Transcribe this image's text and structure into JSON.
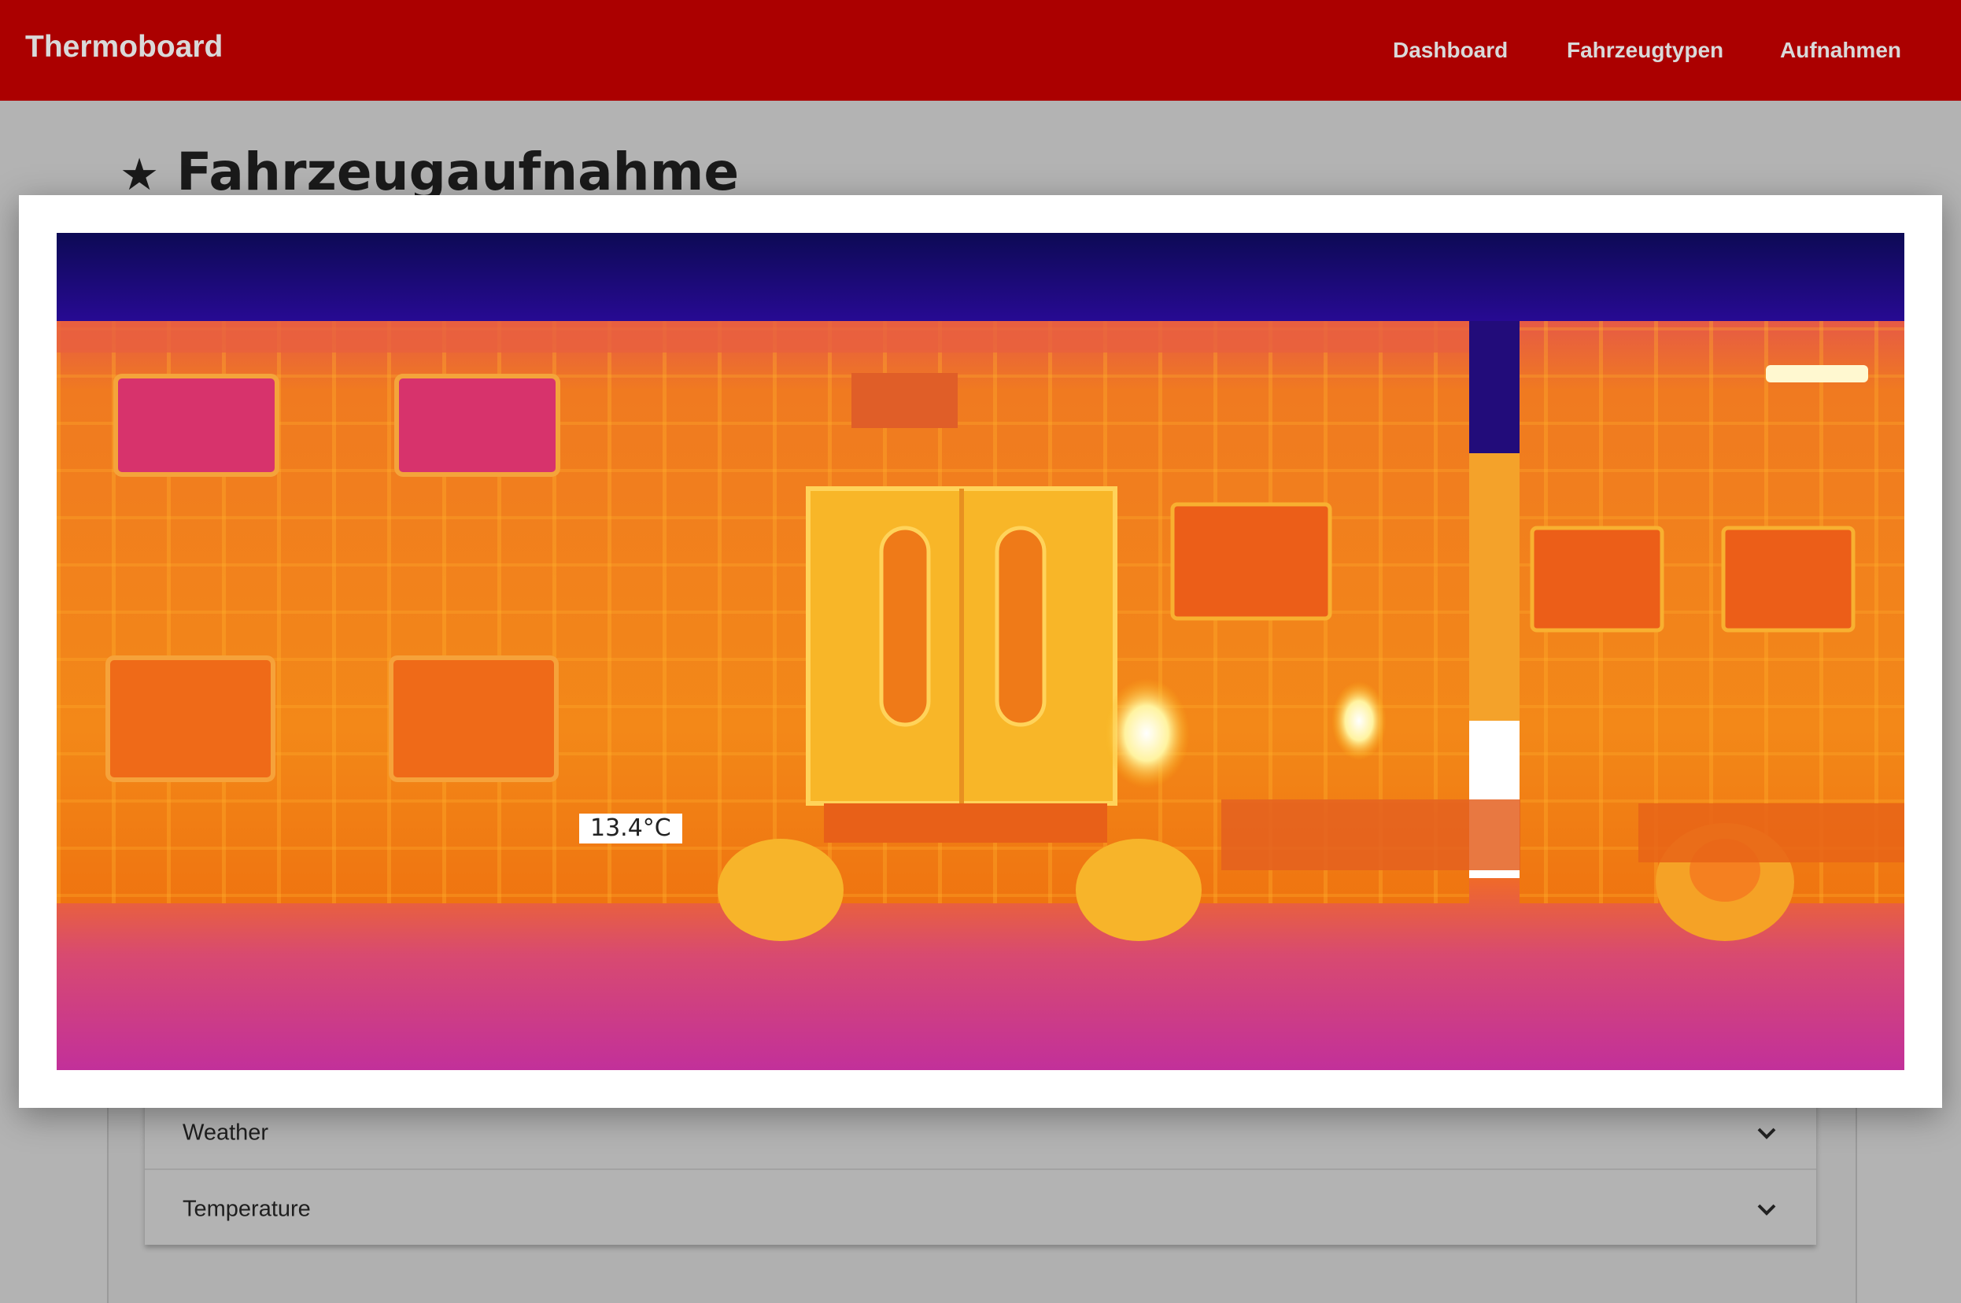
{
  "navbar": {
    "brand": "Thermoboard",
    "links": [
      "Dashboard",
      "Fahrzeugtypen",
      "Aufnahmen"
    ]
  },
  "page": {
    "title": "Fahrzeugaufnahme",
    "title_icon": "star-icon"
  },
  "accordion": {
    "items": [
      {
        "label": "Weather",
        "icon": "chevron-down-icon"
      },
      {
        "label": "Temperature",
        "icon": "chevron-down-icon"
      }
    ]
  },
  "modal": {
    "image_description": "thermal-image-train",
    "temperature_label": "13.4°C"
  },
  "colors": {
    "navbar": "#ab0000",
    "overlay_background": "#b3b3b3",
    "thermal_sky": "#1c0a8c",
    "thermal_body": "#f07a18",
    "thermal_hot": "#fff7c8",
    "thermal_cool": "#c8309a"
  }
}
